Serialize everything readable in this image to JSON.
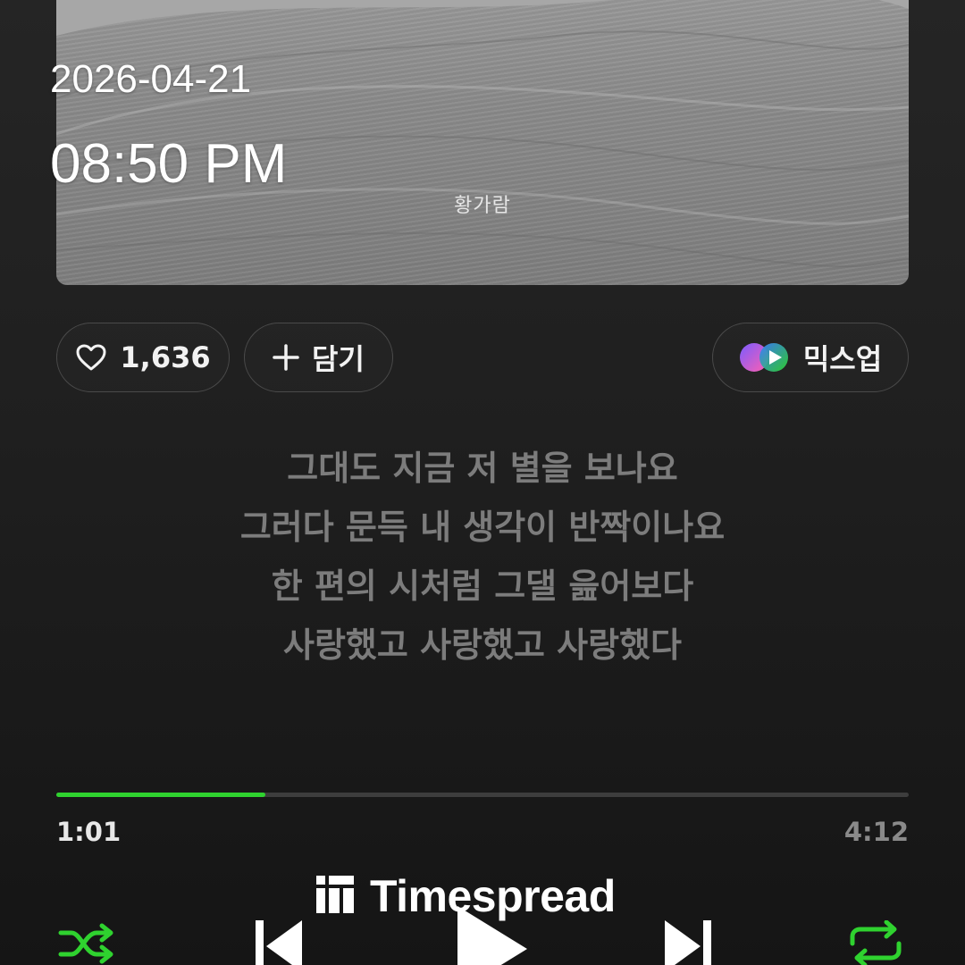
{
  "overlay": {
    "date": "2026-04-21",
    "time": "08:50 PM"
  },
  "album": {
    "artist_signature": "황가람"
  },
  "actions": {
    "like_count": "1,636",
    "add_label": "담기",
    "mixup_label": "믹스업"
  },
  "lyrics": [
    "그대도 지금 저 별을 보나요",
    "그러다 문득 내 생각이 반짝이나요",
    "한 편의 시처럼 그댈 읊어보다",
    "사랑했고 사랑했고 사랑했다"
  ],
  "playback": {
    "current_time": "1:01",
    "total_time": "4:12",
    "progress": 0.245
  },
  "watermark": {
    "text": "Timespread"
  },
  "colors": {
    "accent": "#2fd22f",
    "lyric": "#7c7c7c",
    "pill_border": "#4a4a4a"
  },
  "icons": {
    "like": "heart-icon",
    "add": "plus-icon",
    "mixup": "mixup-logo-icon",
    "shuffle": "shuffle-icon",
    "previous": "skip-previous-icon",
    "play": "play-icon",
    "next": "skip-next-icon",
    "repeat": "repeat-icon"
  }
}
